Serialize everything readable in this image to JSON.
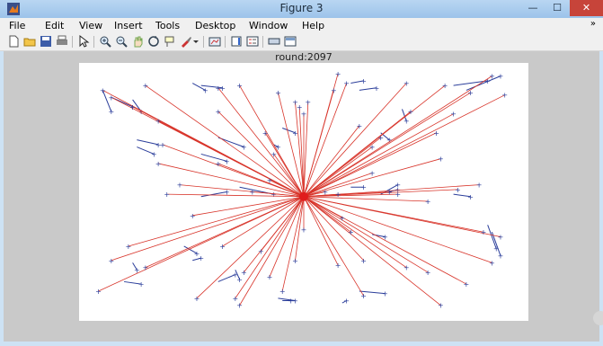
{
  "window": {
    "title": "Figure 3",
    "minimize": "—",
    "maximize": "☐",
    "close": "✕"
  },
  "menu": [
    "File",
    "Edit",
    "View",
    "Insert",
    "Tools",
    "Desktop",
    "Window",
    "Help"
  ],
  "menu_overflow": "»",
  "toolbar_icons": [
    "new-figure",
    "open-file",
    "save",
    "print",
    "pointer",
    "zoom-in",
    "zoom-out",
    "pan",
    "rotate-3d",
    "data-cursor",
    "brush",
    "brush-menu",
    "link-plot",
    "insert-colorbar",
    "insert-legend",
    "hide-plot-tools",
    "show-plot-tools"
  ],
  "plot": {
    "title": "round:2097"
  },
  "colors": {
    "link": "#d8342a",
    "node": "#2a3d9a",
    "window_bg": "#cde2f4",
    "figure_bg": "#c9c9c9"
  },
  "chart_data": {
    "type": "scatter",
    "title": "round:2097",
    "description_xlabel": "",
    "xlim": [
      0,
      100
    ],
    "ylim": [
      0,
      100
    ],
    "sink": {
      "x": 50,
      "y": 48
    },
    "cluster_heads": [
      [
        3,
        93
      ],
      [
        5,
        90
      ],
      [
        10,
        86
      ],
      [
        13,
        95
      ],
      [
        16,
        80
      ],
      [
        17,
        70
      ],
      [
        16,
        62
      ],
      [
        18,
        49
      ],
      [
        21,
        53
      ],
      [
        24,
        40
      ],
      [
        30,
        62
      ],
      [
        30,
        84
      ],
      [
        30,
        94
      ],
      [
        35,
        95
      ],
      [
        38,
        50
      ],
      [
        42,
        55
      ],
      [
        43,
        66
      ],
      [
        41,
        75
      ],
      [
        44,
        92
      ],
      [
        50,
        83
      ],
      [
        48,
        88
      ],
      [
        50,
        34
      ],
      [
        42,
        14
      ],
      [
        48,
        21
      ],
      [
        40,
        25
      ],
      [
        45,
        8
      ],
      [
        34,
        5
      ],
      [
        36,
        16
      ],
      [
        31,
        27
      ],
      [
        35,
        2
      ],
      [
        25,
        5
      ],
      [
        13,
        18
      ],
      [
        9,
        27
      ],
      [
        5,
        21
      ],
      [
        2,
        8
      ],
      [
        58,
        49
      ],
      [
        59,
        39
      ],
      [
        61,
        33
      ],
      [
        58,
        19
      ],
      [
        64,
        21
      ],
      [
        64,
        6
      ],
      [
        74,
        18
      ],
      [
        82,
        2
      ],
      [
        79,
        16
      ],
      [
        88,
        11
      ],
      [
        94,
        20
      ],
      [
        92,
        33
      ],
      [
        96,
        31
      ],
      [
        91,
        53
      ],
      [
        82,
        64
      ],
      [
        81,
        75
      ],
      [
        85,
        83
      ],
      [
        89,
        92
      ],
      [
        94,
        99
      ],
      [
        97,
        91
      ],
      [
        83,
        95
      ],
      [
        75,
        84
      ],
      [
        74,
        96
      ],
      [
        68,
        73
      ],
      [
        66,
        69
      ],
      [
        66,
        58
      ],
      [
        63,
        78
      ],
      [
        60,
        96
      ],
      [
        57,
        93
      ],
      [
        58,
        100
      ],
      [
        51,
        88
      ],
      [
        49,
        86
      ],
      [
        70,
        50
      ],
      [
        72,
        49
      ],
      [
        79,
        46
      ],
      [
        86,
        51
      ],
      [
        55,
        50
      ]
    ],
    "member_links": [
      [
        [
          3,
          93
        ],
        [
          5,
          84
        ]
      ],
      [
        [
          5,
          90
        ],
        [
          10,
          86
        ]
      ],
      [
        [
          10,
          89
        ],
        [
          12,
          84
        ]
      ],
      [
        [
          11,
          69
        ],
        [
          15,
          66
        ]
      ],
      [
        [
          11,
          72
        ],
        [
          16,
          70
        ]
      ],
      [
        [
          26,
          95
        ],
        [
          31,
          94
        ]
      ],
      [
        [
          24,
          96
        ],
        [
          27,
          93
        ]
      ],
      [
        [
          30,
          73
        ],
        [
          36,
          69
        ]
      ],
      [
        [
          26,
          66
        ],
        [
          32,
          63
        ]
      ],
      [
        [
          26,
          48
        ],
        [
          32,
          50
        ]
      ],
      [
        [
          35,
          52
        ],
        [
          43,
          49
        ]
      ],
      [
        [
          45,
          77
        ],
        [
          48,
          75
        ]
      ],
      [
        [
          43,
          70
        ],
        [
          44,
          69
        ]
      ],
      [
        [
          63,
          93
        ],
        [
          67,
          94
        ]
      ],
      [
        [
          61,
          96
        ],
        [
          64,
          97
        ]
      ],
      [
        [
          73,
          85
        ],
        [
          74,
          80
        ]
      ],
      [
        [
          68,
          75
        ],
        [
          70,
          72
        ]
      ],
      [
        [
          85,
          95
        ],
        [
          93,
          97
        ]
      ],
      [
        [
          88,
          93
        ],
        [
          96,
          99
        ]
      ],
      [
        [
          61,
          52
        ],
        [
          64,
          52
        ]
      ],
      [
        [
          68,
          49
        ],
        [
          72,
          53
        ]
      ],
      [
        [
          70,
          50
        ],
        [
          72,
          51
        ]
      ],
      [
        [
          85,
          49
        ],
        [
          89,
          48
        ]
      ],
      [
        [
          10,
          20
        ],
        [
          11,
          17
        ]
      ],
      [
        [
          8,
          12
        ],
        [
          12,
          11
        ]
      ],
      [
        [
          22,
          27
        ],
        [
          25,
          24
        ]
      ],
      [
        [
          24,
          21
        ],
        [
          26,
          22
        ]
      ],
      [
        [
          30,
          12
        ],
        [
          34,
          15
        ]
      ],
      [
        [
          34,
          17
        ],
        [
          35,
          13
        ]
      ],
      [
        [
          44,
          5
        ],
        [
          48,
          4
        ]
      ],
      [
        [
          45,
          4
        ],
        [
          47,
          4
        ]
      ],
      [
        [
          59,
          3
        ],
        [
          60,
          4
        ]
      ],
      [
        [
          66,
          32
        ],
        [
          69,
          31
        ]
      ],
      [
        [
          63,
          8
        ],
        [
          69,
          7
        ]
      ],
      [
        [
          93,
          36
        ],
        [
          95,
          26
        ]
      ],
      [
        [
          94,
          33
        ],
        [
          96,
          23
        ]
      ]
    ]
  }
}
